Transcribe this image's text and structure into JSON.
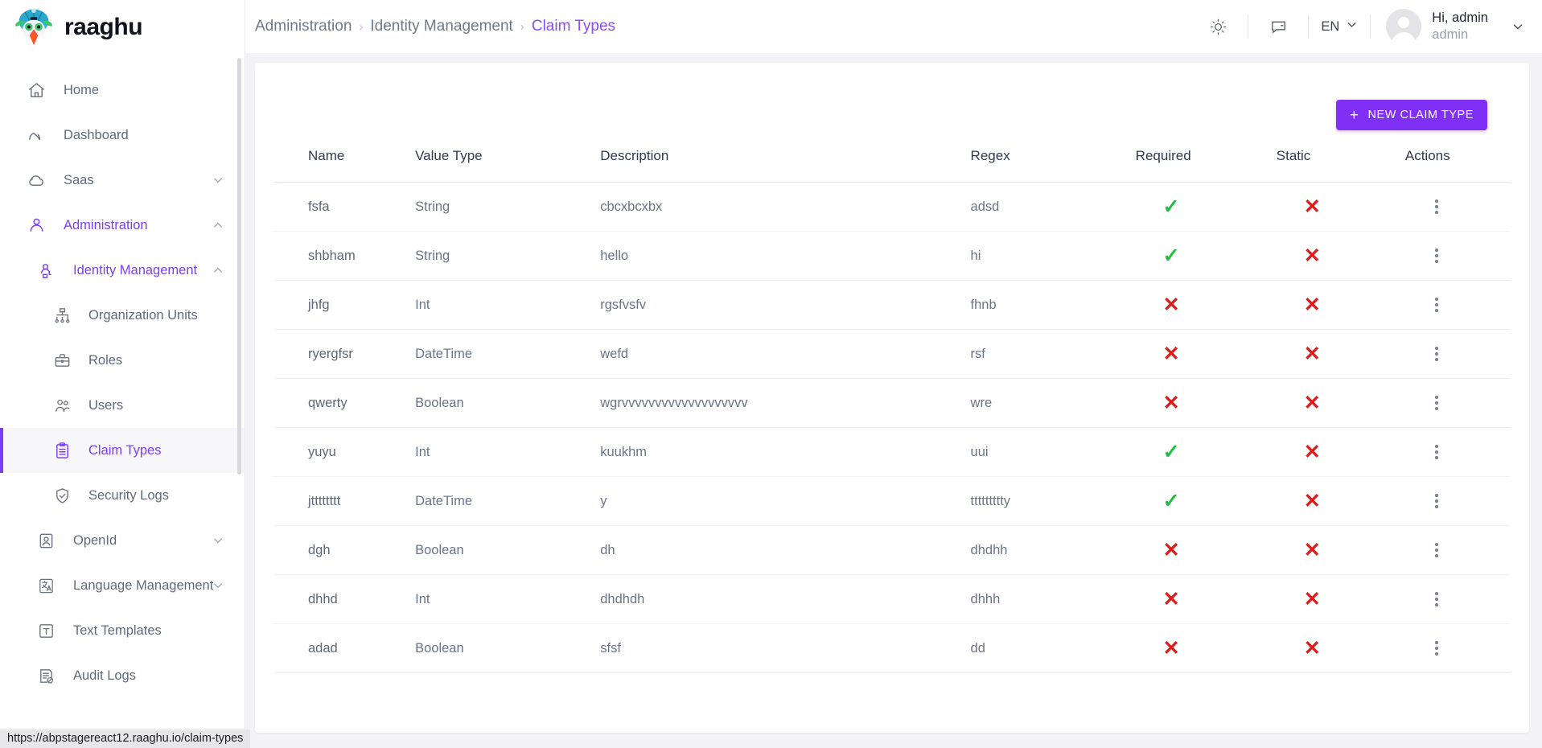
{
  "brand": {
    "name": "raaghu",
    "logo_icon": "raaghu-bird-logo-icon"
  },
  "sidebar": {
    "items": [
      {
        "label": "Home",
        "icon": "home-icon",
        "level": 0,
        "state": "normal",
        "chevron": "none"
      },
      {
        "label": "Dashboard",
        "icon": "dashboard-speedometer-icon",
        "level": 0,
        "state": "normal",
        "chevron": "none"
      },
      {
        "label": "Saas",
        "icon": "cloud-icon",
        "level": 0,
        "state": "normal",
        "chevron": "down"
      },
      {
        "label": "Administration",
        "icon": "user-admin-icon",
        "level": 0,
        "state": "active",
        "chevron": "up"
      },
      {
        "label": "Identity Management",
        "icon": "identity-hierarchy-icon",
        "level": 1,
        "state": "active",
        "chevron": "up"
      },
      {
        "label": "Organization Units",
        "icon": "org-units-icon",
        "level": 2,
        "state": "normal",
        "chevron": "none"
      },
      {
        "label": "Roles",
        "icon": "briefcase-icon",
        "level": 2,
        "state": "normal",
        "chevron": "none"
      },
      {
        "label": "Users",
        "icon": "users-icon",
        "level": 2,
        "state": "normal",
        "chevron": "none"
      },
      {
        "label": "Claim Types",
        "icon": "clipboard-list-icon",
        "level": 2,
        "state": "selected",
        "chevron": "none"
      },
      {
        "label": "Security Logs",
        "icon": "shield-check-icon",
        "level": 2,
        "state": "normal",
        "chevron": "none"
      },
      {
        "label": "OpenId",
        "icon": "openid-user-badge-icon",
        "level": 1,
        "state": "normal",
        "chevron": "down"
      },
      {
        "label": "Language Management",
        "icon": "translate-icon",
        "level": 1,
        "state": "normal",
        "chevron": "down"
      },
      {
        "label": "Text Templates",
        "icon": "text-template-icon",
        "level": 1,
        "state": "normal",
        "chevron": "none"
      },
      {
        "label": "Audit Logs",
        "icon": "audit-logs-icon",
        "level": 1,
        "state": "normal",
        "chevron": "none"
      }
    ]
  },
  "topbar": {
    "breadcrumb": [
      {
        "label": "Administration",
        "current": false
      },
      {
        "label": "Identity Management",
        "current": false
      },
      {
        "label": "Claim Types",
        "current": true
      }
    ],
    "separator": "›",
    "theme_icon": "brightness-sun-icon",
    "chat_icon": "chat-bubble-icon",
    "language": {
      "code": "EN",
      "chevron_icon": "chevron-down-icon"
    },
    "profile": {
      "greeting": "Hi, admin",
      "username": "admin",
      "avatar_icon": "user-avatar-icon",
      "chevron_icon": "chevron-down-icon"
    }
  },
  "toolbar": {
    "new_claim_type_label": "NEW CLAIM TYPE",
    "plus_icon": "plus-icon",
    "accent_color": "#8030f5"
  },
  "table": {
    "columns": [
      "Name",
      "Value Type",
      "Description",
      "Regex",
      "Required",
      "Static",
      "Actions"
    ],
    "rows": [
      {
        "name": "fsfa",
        "value_type": "String",
        "description": "cbcxbcxbx",
        "regex": "adsd",
        "required": true,
        "static": false
      },
      {
        "name": "shbham",
        "value_type": "String",
        "description": "hello",
        "regex": "hi",
        "required": true,
        "static": false
      },
      {
        "name": "jhfg",
        "value_type": "Int",
        "description": "rgsfvsfv",
        "regex": "fhnb",
        "required": false,
        "static": false
      },
      {
        "name": "ryergfsr",
        "value_type": "DateTime",
        "description": "wefd",
        "regex": "rsf",
        "required": false,
        "static": false
      },
      {
        "name": "qwerty",
        "value_type": "Boolean",
        "description": "wgrvvvvvvvvvvvvvvvvvvv",
        "regex": "wre",
        "required": false,
        "static": false
      },
      {
        "name": "yuyu",
        "value_type": "Int",
        "description": "kuukhm",
        "regex": "uui",
        "required": true,
        "static": false
      },
      {
        "name": "jtttttttt",
        "value_type": "DateTime",
        "description": "y",
        "regex": "ttttttttty",
        "required": true,
        "static": false
      },
      {
        "name": "dgh",
        "value_type": "Boolean",
        "description": "dh",
        "regex": "dhdhh",
        "required": false,
        "static": false
      },
      {
        "name": "dhhd",
        "value_type": "Int",
        "description": "dhdhdh",
        "regex": "dhhh",
        "required": false,
        "static": false
      },
      {
        "name": "adad",
        "value_type": "Boolean",
        "description": "sfsf",
        "regex": "dd",
        "required": false,
        "static": false
      }
    ],
    "marks": {
      "yes": "✓",
      "no": "✕",
      "yes_color": "#20c040",
      "no_color": "#e01b1b"
    },
    "row_action_icon": "kebab-menu-icon"
  },
  "statusbar": {
    "url": "https://abpstagereact12.raaghu.io/claim-types"
  }
}
